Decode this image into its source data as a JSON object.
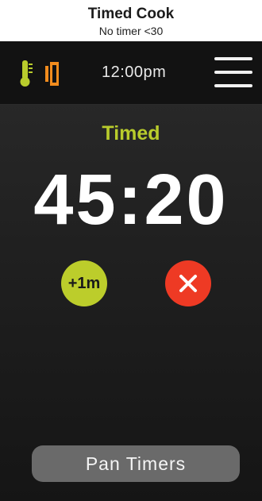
{
  "page": {
    "title": "Timed Cook",
    "subtitle": "No timer <30"
  },
  "status_bar": {
    "time": "12:00pm",
    "icons": {
      "thermometer": "thermometer-icon",
      "door": "oven-door-icon",
      "menu": "hamburger-menu-icon"
    },
    "colors": {
      "thermometer": "#b9cc2c",
      "door": "#f28c1d"
    }
  },
  "main": {
    "mode_label": "Timed",
    "timer": "45:20",
    "add_button_label": "+1m",
    "cancel_icon": "close-icon",
    "bottom_button_label": "Pan Timers"
  },
  "colors": {
    "accent_green": "#bccd2b",
    "cancel_red": "#ee3a24",
    "pan_button_gray": "#6a6a6a"
  }
}
